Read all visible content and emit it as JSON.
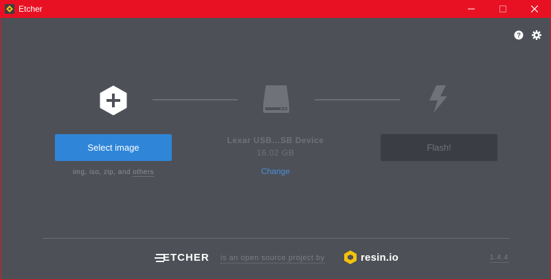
{
  "window": {
    "title": "Etcher",
    "accent_color": "#e81123",
    "icons": [
      "etcher-app-icon",
      "minimize-icon",
      "maximize-icon",
      "close-icon"
    ]
  },
  "header": {
    "icons": [
      "help-icon",
      "gear-icon"
    ]
  },
  "steps": {
    "image": {
      "icon": "plus-icon",
      "button_label": "Select image",
      "hint_prefix": "img, iso, zip, and ",
      "hint_link": "others",
      "button_color": "#2f86d8"
    },
    "drive": {
      "icon": "drive-icon",
      "name": "Lexar USB…SB Device",
      "size": "16.02 GB",
      "change_label": "Change",
      "link_color": "#4a90d9"
    },
    "flash": {
      "icon": "lightning-icon",
      "button_label": "Flash!"
    }
  },
  "footer": {
    "etcher_brand": "ETCHER",
    "tagline": "is an open source project by",
    "resin_brand": "resin.io",
    "version": "1.4.4"
  }
}
